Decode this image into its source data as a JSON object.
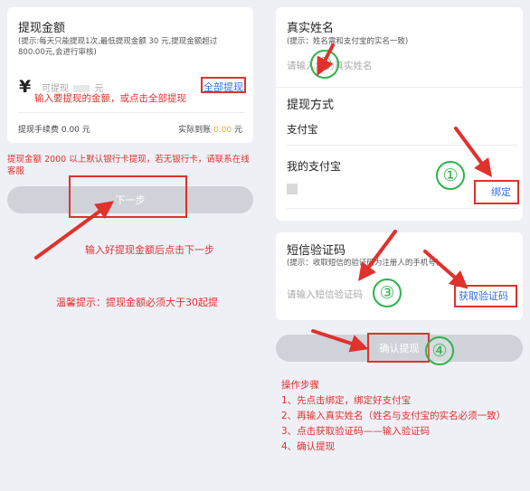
{
  "left": {
    "withdraw_title": "提现金额",
    "withdraw_hint": "(提示:每天只能提现1次,最低提现金额 30 元,提现金额超过 800.00元,会进行审核)",
    "currency_symbol": "¥",
    "amount_placeholder_a": "可提现",
    "amount_placeholder_b": "元",
    "withdraw_all": "全部提现",
    "annotation_amount": "输入要提现的金额，或点击全部提现",
    "fee_label": "提现手续费 0.00 元",
    "actual_label": "实际到账",
    "actual_value": "0.00",
    "actual_unit": "元",
    "bank_notice": "提现金额 2000 以上默认银行卡提现，若无银行卡，请联系在线客服",
    "next_button": "下一步",
    "annotation_next": "输入好提现金额后点击下一步",
    "warm_tip": "温馨提示：提现金额必须大于30起提"
  },
  "right": {
    "realname_title": "真实姓名",
    "realname_hint": "(提示：姓名需和支付宝的实名一致)",
    "realname_placeholder": "请输入您的真实姓名",
    "method_title": "提现方式",
    "method_value": "支付宝",
    "my_alipay_title": "我的支付宝",
    "bind_button": "绑定",
    "sms_title": "短信验证码",
    "sms_hint": "(提示：收取短信的验证码为注册人的手机号)",
    "sms_placeholder": "请输入短信验证码",
    "get_code_button": "获取验证码",
    "confirm_button": "确认提现",
    "steps_title": "操作步骤",
    "steps": [
      "1、先点击绑定，绑定好支付宝",
      "2、再输入真实姓名（姓名与支付宝的实名必须一致）",
      "3、点击获取验证码——输入验证码",
      "4、确认提现"
    ]
  },
  "markers": [
    "①",
    "②",
    "③",
    "④"
  ],
  "colors": {
    "annotation_red": "#e0312d",
    "marker_green": "#2fb34a",
    "link_blue": "#2f6fe0",
    "accent_orange": "#f5a623",
    "button_gray": "#cfd2d8"
  }
}
